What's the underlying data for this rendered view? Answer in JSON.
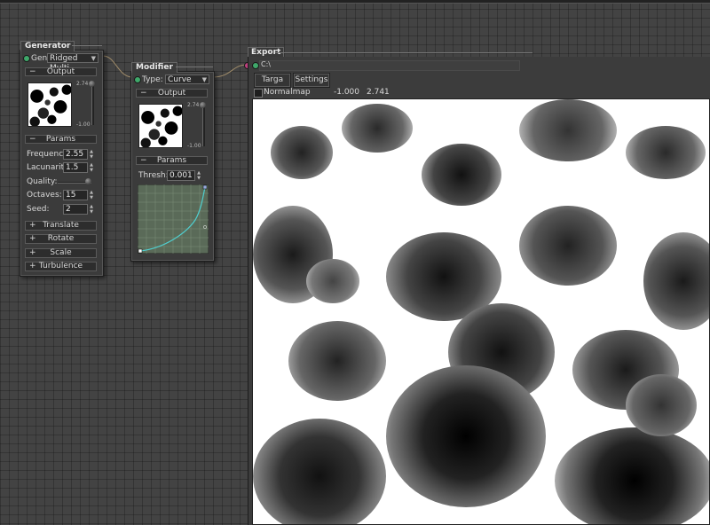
{
  "generator": {
    "title": "Generator",
    "gen_label": "Gen:",
    "gen_value": "Ridged Multi",
    "output_label": "Output",
    "range_max": "2.74",
    "range_min": "-1.00",
    "params_label": "Params",
    "params": [
      {
        "label": "Frequency:",
        "value": "2.55"
      },
      {
        "label": "Lacunarity:",
        "value": "1.5"
      },
      {
        "label": "Quality:",
        "value": ""
      },
      {
        "label": "Octaves:",
        "value": "15"
      },
      {
        "label": "Seed:",
        "value": "2"
      }
    ],
    "quality_level": 1.0,
    "sections": [
      "Translate",
      "Rotate",
      "Scale",
      "Turbulence"
    ]
  },
  "modifier": {
    "title": "Modifier",
    "type_label": "Type:",
    "type_value": "Curve",
    "output_label": "Output",
    "range_max": "2.74",
    "range_min": "-1.00",
    "params_label": "Params",
    "thresh_label": "Thresh:",
    "thresh_value": "0.001"
  },
  "export": {
    "title": "Export",
    "path": "C:\\",
    "buttons": [
      "Targa",
      "Settings"
    ],
    "normalmap_label": "Normalmap",
    "min_value": "-1.000",
    "max_value": "2.741"
  },
  "symbols": {
    "minus": "−",
    "plus": "+",
    "up": "▲",
    "down": "▼",
    "dropdown": "▼"
  },
  "colors": {
    "connector_dot": "#3fa86a",
    "background": "#434343",
    "curve": "#4fd0d0"
  }
}
